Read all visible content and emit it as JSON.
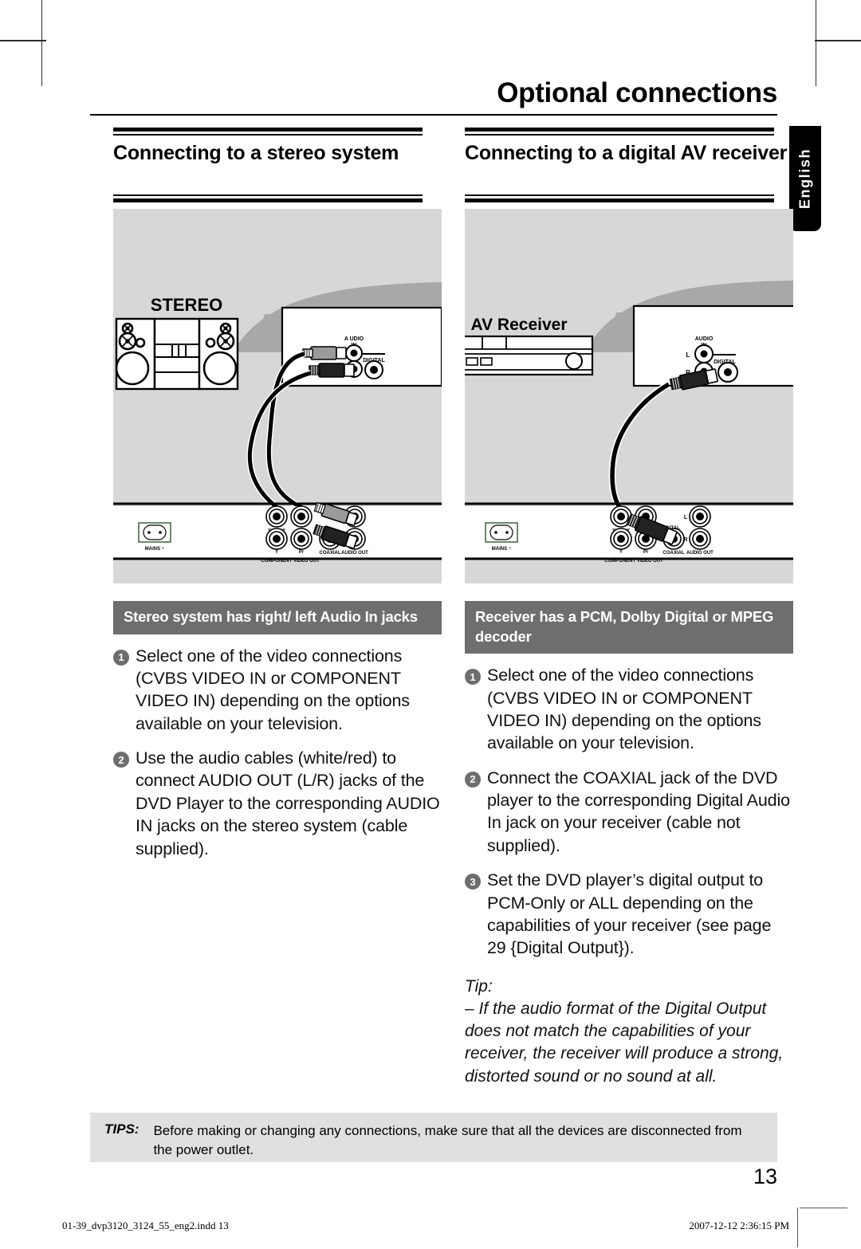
{
  "header": {
    "title": "Optional connections"
  },
  "language_tab": {
    "label": "English"
  },
  "columns": [
    {
      "id": "stereo",
      "section_title": "Connecting to a stereo system",
      "caption_bar": "Stereo system has right/ left Audio In jacks",
      "diagram": {
        "device_label": "STEREO",
        "panel_labels": {
          "audio_in": "A UDIO",
          "audio_in_2": "IN",
          "digital": "DIGITAL"
        },
        "player_labels": {
          "mains": "MAINS",
          "tv_out": "TV OUT",
          "pb": "Pb",
          "y": "Y",
          "pr": "Pr",
          "coaxial": "COAXIAL",
          "audio_out": "AUDIO OUT",
          "component_video_out": "COMPONENT VIDEO OUT"
        }
      },
      "steps": [
        {
          "num": "1",
          "text": "Select one of the video connections (CVBS VIDEO IN or COMPONENT VIDEO IN) depending on the options available on your television."
        },
        {
          "num": "2",
          "text": "Use the audio cables (white/red) to connect AUDIO OUT (L/R) jacks of the DVD Player to the corresponding AUDIO IN jacks on the stereo system (cable supplied)."
        }
      ],
      "tip": null
    },
    {
      "id": "av-receiver",
      "section_title": "Connecting to a digital AV receiver",
      "caption_bar": "Receiver has a PCM, Dolby Digital or MPEG decoder",
      "diagram": {
        "device_label": "AV Receiver",
        "panel_labels": {
          "audio_in": "AUDIO",
          "audio_in_2": "IN",
          "left": "L",
          "right": "R",
          "digital": "DIGITAL"
        },
        "player_labels": {
          "mains": "MAINS",
          "tv_out": "TV OUT",
          "pb": "Pb",
          "y": "Y",
          "pr": "Pr",
          "coaxial": "COAXIAL",
          "digital_out": "DIGITAL",
          "digital_out_2": "OUT",
          "audio_out": "AUDIO OUT",
          "left": "L",
          "right": "R",
          "component_video_out": "COMPONENT VIDEO OUT"
        }
      },
      "steps": [
        {
          "num": "1",
          "text": "Select one of the video connections (CVBS VIDEO IN or COMPONENT VIDEO IN) depending on the options available on your television."
        },
        {
          "num": "2",
          "text": "Connect the COAXIAL jack of the DVD player to the corresponding Digital Audio In jack on your receiver (cable not supplied)."
        },
        {
          "num": "3",
          "text": "Set the DVD player’s digital output to PCM-Only or ALL depending on the capabilities of your receiver (see page 29 {Digital Output})."
        }
      ],
      "tip": {
        "label": "Tip:",
        "body": "–  If the audio format of the Digital Output does not match the capabilities of your receiver, the receiver will produce a strong, distorted sound or no sound at all."
      }
    }
  ],
  "tips_footer": {
    "label": "TIPS:",
    "text": "Before making or changing any connections, make sure that all the devices are disconnected from the power outlet."
  },
  "page_number": "13",
  "running_footer": {
    "file": "01-39_dvp3120_3124_55_eng2.indd   13",
    "date": "2007-12-12   2:36:15 PM"
  },
  "colors": {
    "diagram_bg": "#d7d7d7",
    "caption_bar_bg": "#6e6e6e",
    "tips_box_bg": "#e0e0e0",
    "tab_bg": "#000000"
  }
}
